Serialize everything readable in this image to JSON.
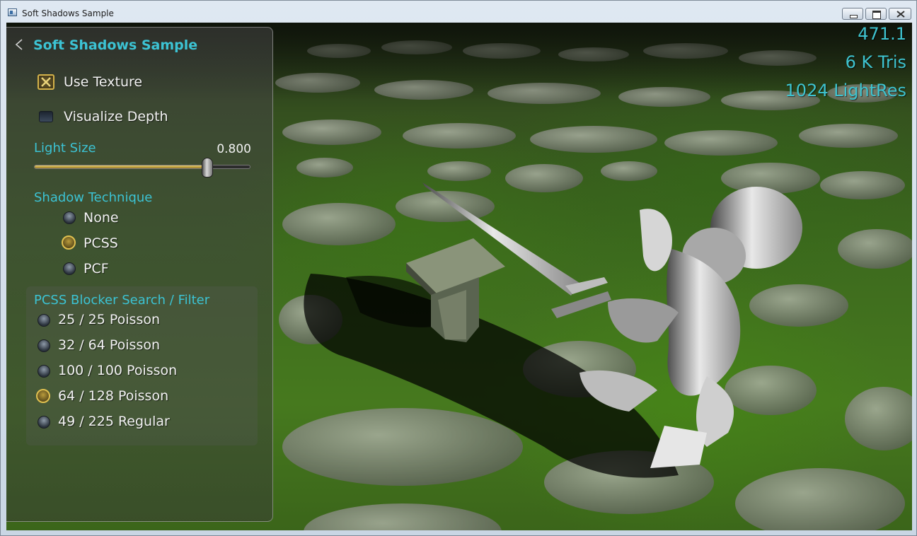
{
  "window": {
    "title": "Soft Shadows Sample"
  },
  "stats": {
    "fps": "471.1",
    "tris": "6 K Tris",
    "light_res": "1024 LightRes"
  },
  "panel": {
    "title": "Soft Shadows Sample",
    "use_texture": {
      "label": "Use Texture",
      "checked": true
    },
    "visualize_depth": {
      "label": "Visualize Depth",
      "checked": false
    },
    "light_size": {
      "label": "Light Size",
      "value": "0.800",
      "fraction": 0.8
    },
    "shadow_technique": {
      "label": "Shadow Technique",
      "options": [
        {
          "label": "None",
          "selected": false
        },
        {
          "label": "PCSS",
          "selected": true
        },
        {
          "label": "PCF",
          "selected": false
        }
      ]
    },
    "pcss_filter": {
      "label": "PCSS Blocker Search / Filter",
      "options": [
        {
          "label": "25 / 25 Poisson",
          "selected": false
        },
        {
          "label": "32 / 64 Poisson",
          "selected": false
        },
        {
          "label": "100 / 100 Poisson",
          "selected": false
        },
        {
          "label": "64 / 128 Poisson",
          "selected": true
        },
        {
          "label": "49 / 225 Regular",
          "selected": false
        }
      ]
    }
  },
  "colors": {
    "accent": "#3cc3d4",
    "selected": "#e0c050",
    "stats": "#3ec3cf"
  }
}
